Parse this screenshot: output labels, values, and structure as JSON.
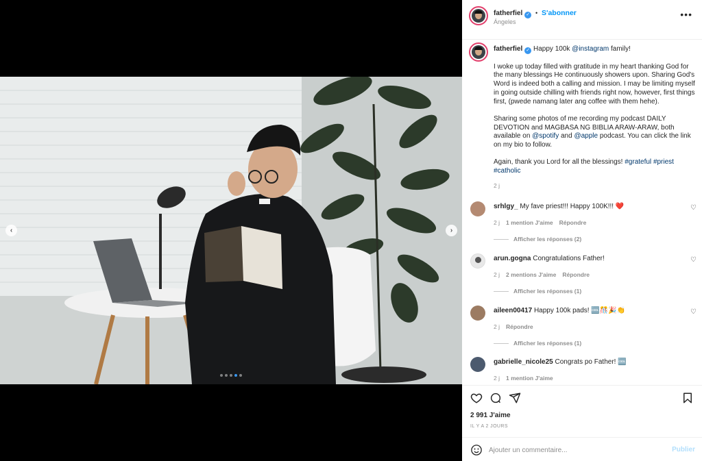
{
  "post": {
    "username": "fatherfiel",
    "follow_label": "S'abonner",
    "separator": "•",
    "location": "Ángeles",
    "more_icon": "more-horizontal-icon",
    "carousel_dots": 5,
    "carousel_active": 4
  },
  "caption": {
    "username": "fatherfiel",
    "line1_text": "Happy 100k ",
    "line1_mention": "@instagram",
    "line1_end": " family!",
    "p2": "I woke up today filled with gratitude in my heart thanking God for the many blessings He continuously showers upon. Sharing God's Word is indeed both a calling and mission. I may be limiting myself in going outside chilling with friends right now, however, first things first, (pwede namang later ang coffee with them hehe).",
    "p3_a": "Sharing some photos of me recording my podcast DAILY DEVOTION and MAGBASA NG BIBLIA ARAW-ARAW, both available on ",
    "p3_spotify": "@spotify",
    "p3_b": " and ",
    "p3_apple": "@apple",
    "p3_c": " podcast. You can click the link on my bio to follow.",
    "p4_a": "Again, thank you Lord for all the blessings! ",
    "tag1": "#grateful",
    "tag2": "#priest",
    "tag3": "#catholic",
    "time": "2 j"
  },
  "comments": [
    {
      "user": "srhlgy_",
      "text": "My fave priest!!! Happy 100K!!! ❤️",
      "time": "2 j",
      "likes": "1 mention J'aime",
      "reply": "Répondre",
      "view_replies": "Afficher les réponses (2)"
    },
    {
      "user": "arun.gogna",
      "text": "Congratulations Father!",
      "time": "2 j",
      "likes": "2 mentions J'aime",
      "reply": "Répondre",
      "view_replies": "Afficher les réponses (1)"
    },
    {
      "user": "aileen00417",
      "text": "Happy 100k pads! 🆒🎊🎉👏",
      "time": "2 j",
      "likes": "",
      "reply": "Répondre",
      "view_replies": "Afficher les réponses (1)"
    },
    {
      "user": "gabrielle_nicole25",
      "text": "Congrats po Father! 🆒",
      "time": "2 j",
      "likes": "1 mention J'aime",
      "reply": "",
      "view_replies": ""
    }
  ],
  "actions": {
    "like_icon": "heart-icon",
    "comment_icon": "comment-icon",
    "share_icon": "share-icon",
    "save_icon": "bookmark-icon",
    "likes": "2 991 J'aime",
    "date": "IL Y A 2 JOURS"
  },
  "add_comment": {
    "emoji_icon": "emoji-icon",
    "placeholder": "Ajouter un commentaire...",
    "publish_label": "Publier"
  },
  "colors": {
    "accent": "#0095f6",
    "link": "#00376b",
    "muted": "#8e8e8e",
    "heart": "#ed4956"
  }
}
